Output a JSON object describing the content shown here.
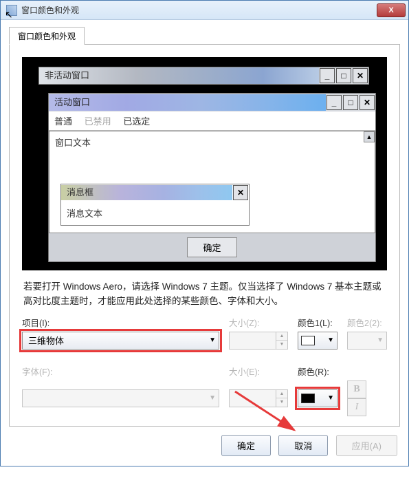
{
  "titlebar": {
    "title": "窗口颜色和外观",
    "close": "X"
  },
  "tab": {
    "label": "窗口颜色和外观"
  },
  "preview": {
    "inactive": {
      "title": "非活动窗口",
      "min": "_",
      "max": "□",
      "close": "✕"
    },
    "active": {
      "title": "活动窗口",
      "min": "_",
      "max": "□",
      "close": "✕",
      "menu_normal": "普通",
      "menu_disabled": "已禁用",
      "menu_selected": "已选定",
      "text": "窗口文本",
      "scroll_up": "▲"
    },
    "msgbox": {
      "title": "消息框",
      "close": "✕",
      "body": "消息文本",
      "ok": "确定"
    }
  },
  "notice": "若要打开 Windows Aero，请选择 Windows 7 主题。仅当选择了 Windows 7 基本主题或高对比度主题时，才能应用此处选择的某些颜色、字体和大小。",
  "labels": {
    "item": "项目(I):",
    "size": "大小(Z):",
    "color1": "颜色1(L):",
    "color2": "颜色2(2):",
    "font": "字体(F):",
    "size2": "大小(E):",
    "colorR": "颜色(R):"
  },
  "values": {
    "item": "三维物体"
  },
  "swatches": {
    "color1": "#ffffff",
    "colorR": "#000000"
  },
  "format": {
    "bold": "B",
    "italic": "I"
  },
  "buttons": {
    "ok": "确定",
    "cancel": "取消",
    "apply": "应用(A)"
  }
}
